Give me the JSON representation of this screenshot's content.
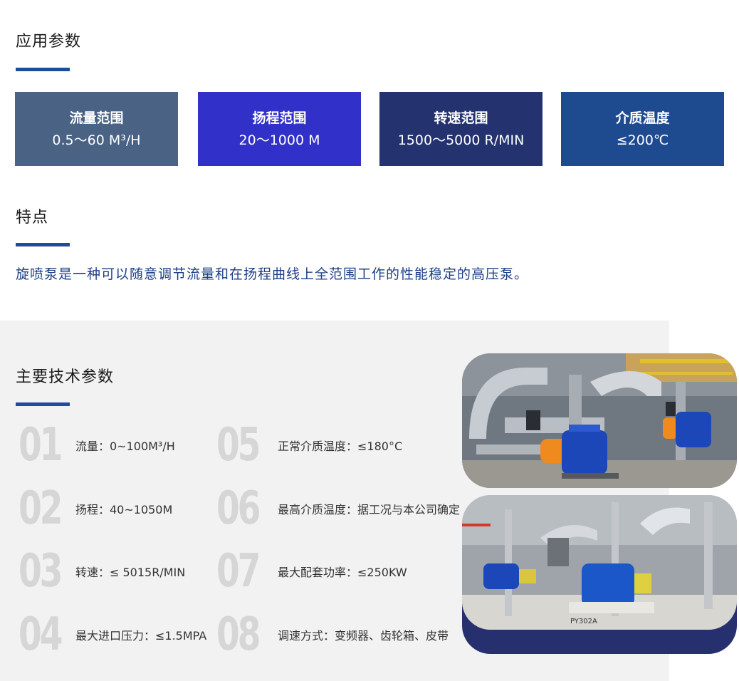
{
  "application": {
    "title": "应用参数",
    "cards": [
      {
        "label": "流量范围",
        "value": "0.5～60 M³/H",
        "color": "#4a6284"
      },
      {
        "label": "扬程范围",
        "value": "20～1000 M",
        "color": "#3131c9"
      },
      {
        "label": "转速范围",
        "value": "1500～5000 R/MIN",
        "color": "#243270"
      },
      {
        "label": "介质温度",
        "value": "≤200℃",
        "color": "#1e4b90"
      }
    ]
  },
  "features": {
    "title": "特点",
    "description": "旋喷泵是一种可以随意调节流量和在扬程曲线上全范围工作的性能稳定的高压泵。"
  },
  "tech": {
    "title": "主要技术参数",
    "params": [
      {
        "num": "01",
        "text": "流量：0~100M³/H"
      },
      {
        "num": "02",
        "text": "扬程：40~1050M"
      },
      {
        "num": "03",
        "text": "转速：≤ 5015R/MIN"
      },
      {
        "num": "04",
        "text": "最大进口压力：≤1.5MPA"
      },
      {
        "num": "05",
        "text": "正常介质温度：≤180°C"
      },
      {
        "num": "06",
        "text": "最高介质温度：据工况与本公司确定"
      },
      {
        "num": "07",
        "text": "最大配套功率：≤250KW"
      },
      {
        "num": "08",
        "text": "调速方式：变频器、齿轮箱、皮带"
      }
    ]
  },
  "photo_label": "PY302A"
}
